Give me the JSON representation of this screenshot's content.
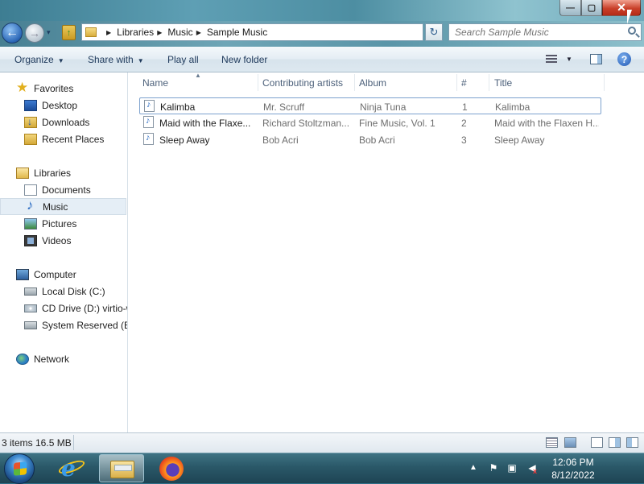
{
  "window": {
    "min_glyph": "—",
    "max_glyph": "▢",
    "close_glyph": "✕"
  },
  "nav": {
    "back_glyph": "←",
    "forward_glyph": "→",
    "dropdown_glyph": "▾",
    "breadcrumbs": [
      "Libraries",
      "Music",
      "Sample Music"
    ],
    "refresh_glyph": "↻",
    "search_placeholder": "Search Sample Music"
  },
  "toolbar": {
    "organize": "Organize",
    "share_with": "Share with",
    "play_all": "Play all",
    "new_folder": "New folder",
    "dropdown_glyph": "▼",
    "help_glyph": "?"
  },
  "sidebar": {
    "favorites": "Favorites",
    "desktop": "Desktop",
    "downloads": "Downloads",
    "recent_places": "Recent Places",
    "libraries": "Libraries",
    "documents": "Documents",
    "music": "Music",
    "pictures": "Pictures",
    "videos": "Videos",
    "computer": "Computer",
    "local_disk": "Local Disk (C:)",
    "cd_drive": "CD Drive (D:) virtio-w",
    "system_reserved": "System Reserved (E:)",
    "network": "Network"
  },
  "list": {
    "headers": {
      "name": "Name",
      "artists": "Contributing artists",
      "album": "Album",
      "number": "#",
      "title": "Title"
    },
    "rows": [
      {
        "name": "Kalimba",
        "artist": "Mr. Scruff",
        "album": "Ninja Tuna",
        "number": "1",
        "title": "Kalimba"
      },
      {
        "name": "Maid with the Flaxe...",
        "artist": "Richard Stoltzman...",
        "album": "Fine Music, Vol. 1",
        "number": "2",
        "title": "Maid with the Flaxen H..."
      },
      {
        "name": "Sleep Away",
        "artist": "Bob Acri",
        "album": "Bob Acri",
        "number": "3",
        "title": "Sleep Away"
      }
    ]
  },
  "status": {
    "text": "3 items 16.5 MB"
  },
  "taskbar": {
    "clock_time": "12:06 PM",
    "clock_date": "8/12/2022",
    "tray_arrow": "▲",
    "flag_glyph": "⚑",
    "network_glyph": "▣",
    "volume_glyph": "◀",
    "volume_x": "x",
    "ie_glyph": "e"
  }
}
